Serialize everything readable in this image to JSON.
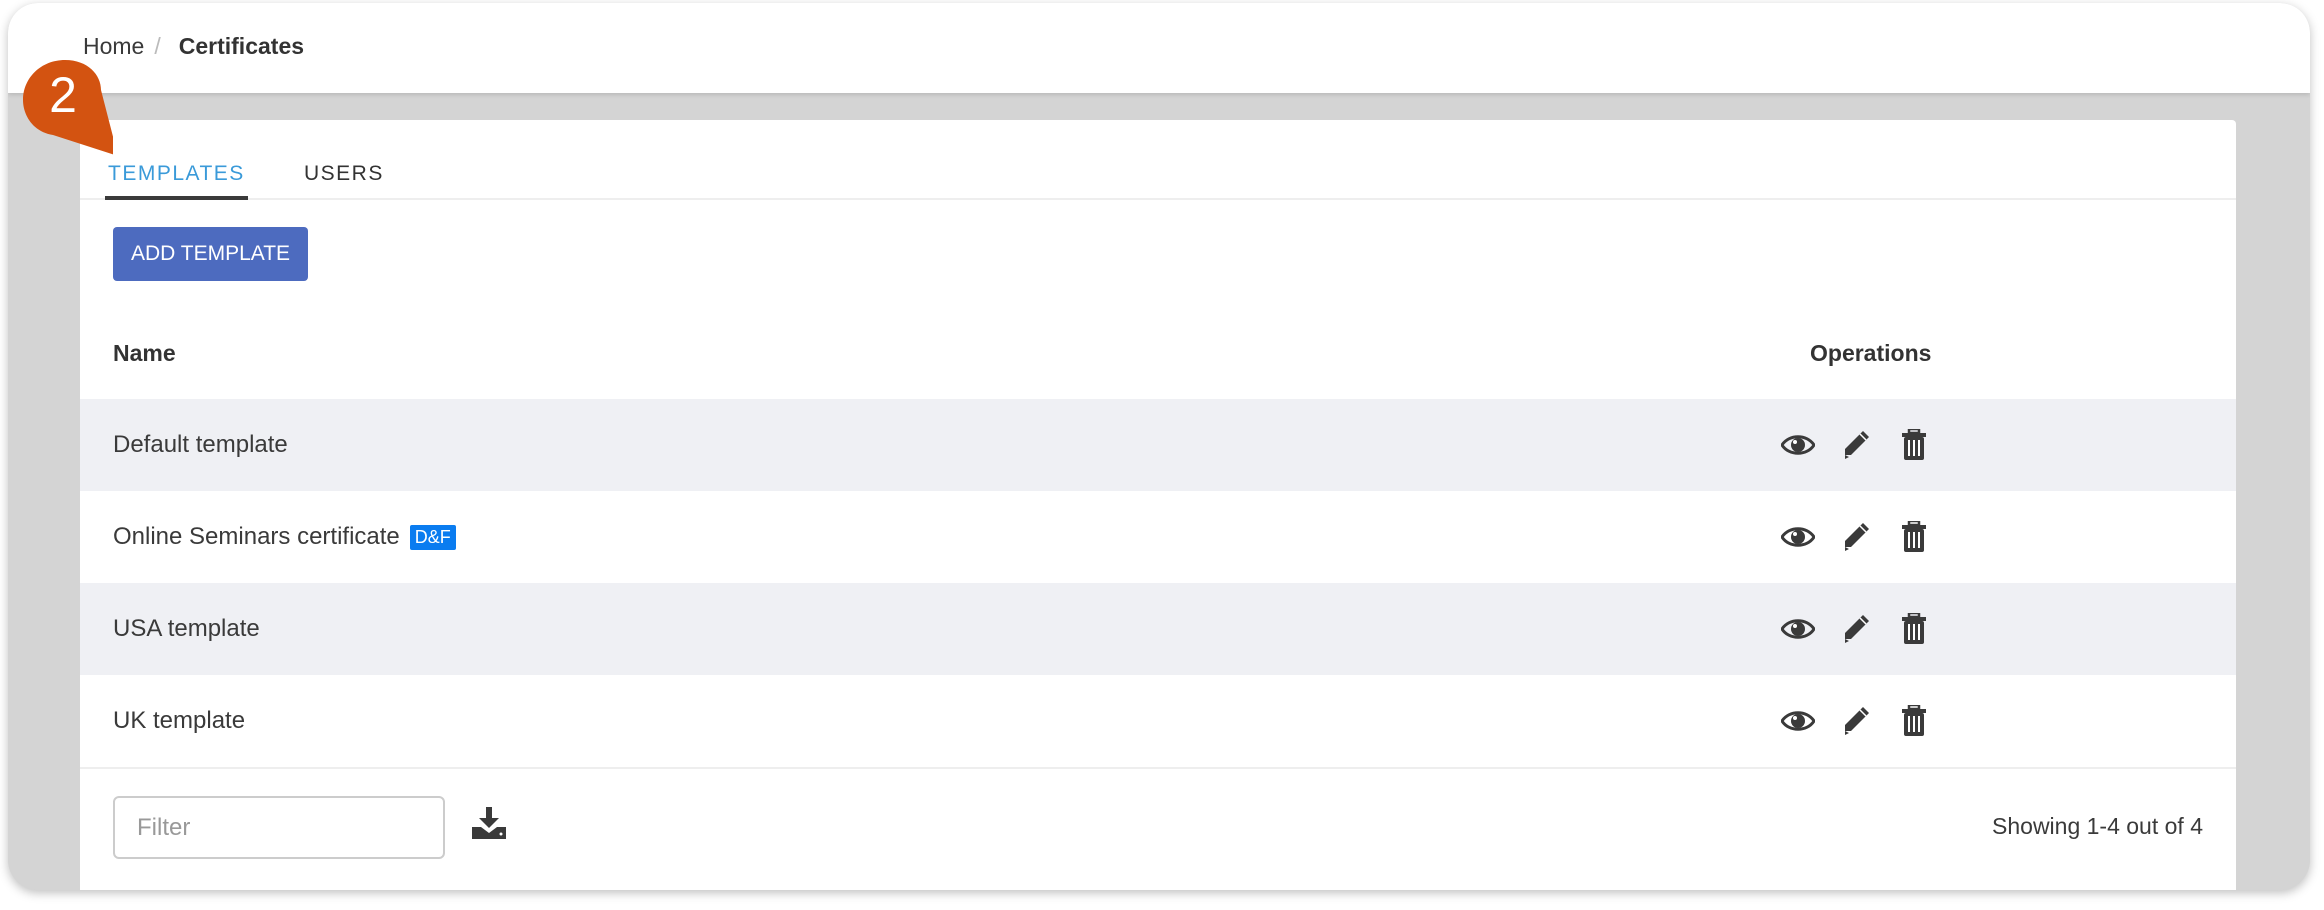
{
  "breadcrumb": {
    "home": "Home",
    "separator": "/",
    "current": "Certificates"
  },
  "annotation": {
    "number": "2",
    "color": "#d35311"
  },
  "tabs": [
    {
      "label": "TEMPLATES",
      "active": true
    },
    {
      "label": "USERS",
      "active": false
    }
  ],
  "toolbar": {
    "add_label": "ADD TEMPLATE"
  },
  "table": {
    "headers": {
      "name": "Name",
      "operations": "Operations"
    },
    "rows": [
      {
        "name": "Default template",
        "badge": null
      },
      {
        "name": "Online Seminars certificate",
        "badge": "D&F"
      },
      {
        "name": "USA template",
        "badge": null
      },
      {
        "name": "UK template",
        "badge": null
      }
    ],
    "operation_icons": [
      "eye-icon",
      "pencil-icon",
      "trash-icon"
    ]
  },
  "footer": {
    "filter_placeholder": "Filter",
    "filter_value": "",
    "download_icon": "download-icon",
    "showing": "Showing 1-4 out of 4"
  },
  "colors": {
    "accent": "#3a9ad9",
    "button": "#4d6bbf",
    "badge": "#0a7cf0",
    "row_alt": "#eff0f4"
  }
}
